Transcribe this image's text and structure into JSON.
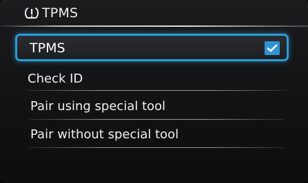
{
  "header": {
    "icon": "tpms-warning-icon",
    "title": "TPMS"
  },
  "menu": {
    "selected_item": {
      "label": "TPMS",
      "checked": true
    },
    "section_label": "Check ID",
    "items": [
      {
        "label": "Pair using special tool"
      },
      {
        "label": "Pair without special tool"
      }
    ]
  },
  "colors": {
    "accent": "#2a9dd8",
    "checkbox": "#2f93d3",
    "text": "#f0f0f0",
    "background": "#141416"
  }
}
